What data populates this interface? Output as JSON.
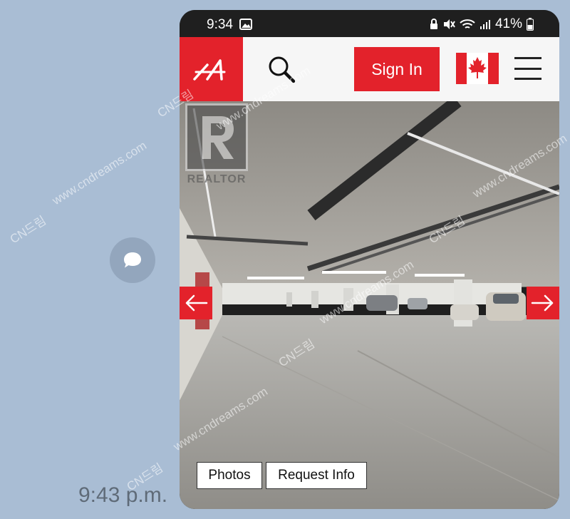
{
  "conversation": {
    "message_time": "9:43 p.m.",
    "share_icon": "speech-bubble-icon"
  },
  "status_bar": {
    "time": "9:34",
    "battery": "41%",
    "icons": [
      "photo-icon",
      "lock-icon",
      "mute-icon",
      "wifi-icon",
      "signal-icon",
      "battery-icon"
    ]
  },
  "header": {
    "logo_icon": "realtor-ca-logo",
    "search_icon": "search-icon",
    "signin_label": "Sign In",
    "flag_icon": "canada-flag-icon",
    "menu_icon": "hamburger-menu-icon",
    "brand_color": "#e3222b"
  },
  "listing_photo": {
    "watermark_text": "REALTOR",
    "prev_icon": "arrow-left-icon",
    "next_icon": "arrow-right-icon",
    "photos_label": "Photos",
    "request_info_label": "Request Info"
  },
  "overlay_watermark": {
    "site": "www.cndreams.com",
    "brand": "CN드림"
  }
}
